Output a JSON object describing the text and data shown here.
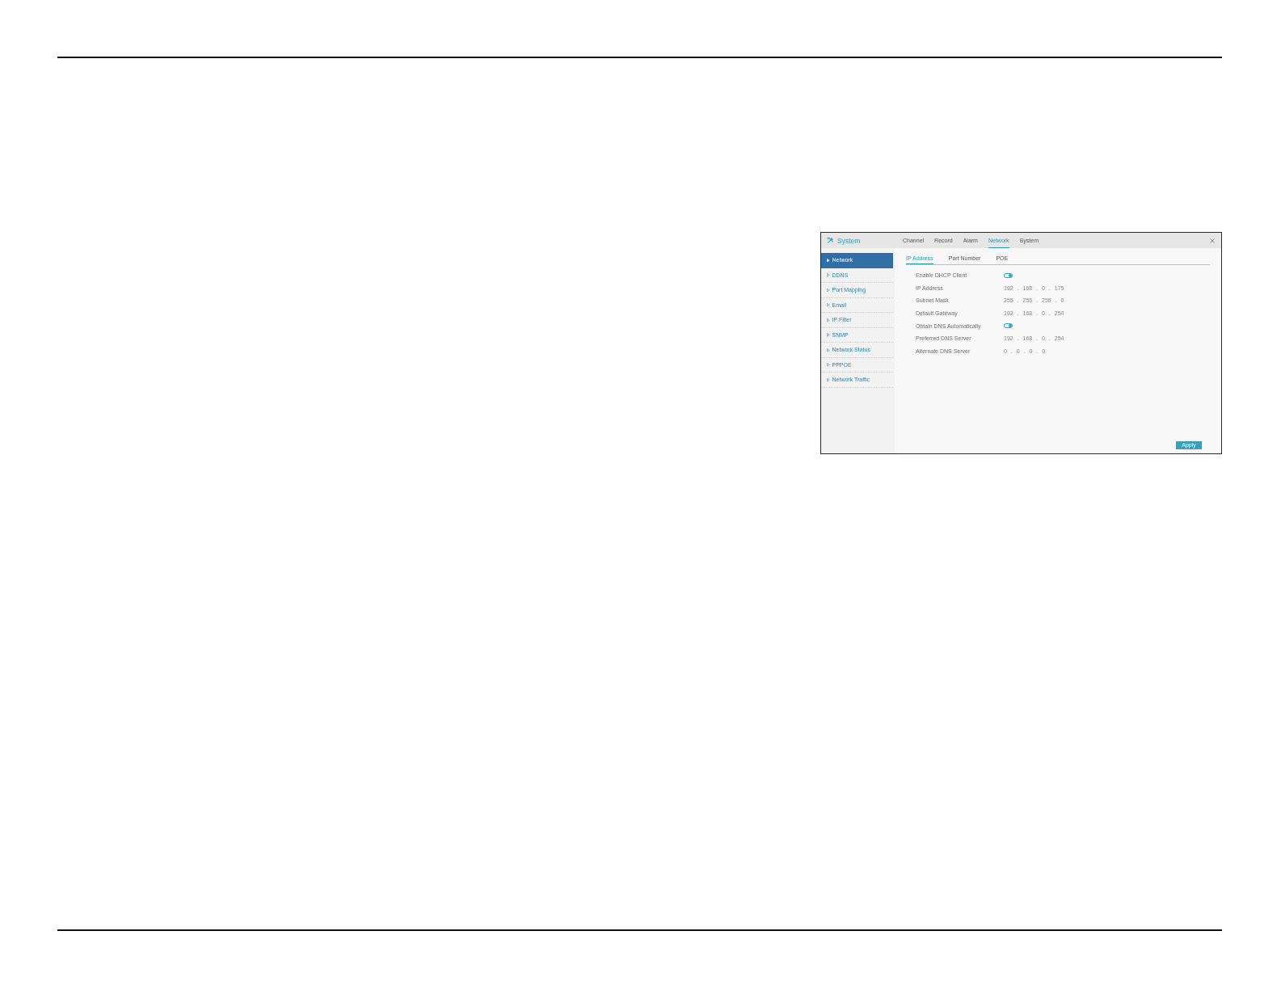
{
  "window": {
    "title": "System"
  },
  "tabs": [
    {
      "label": "Channel",
      "selected": false
    },
    {
      "label": "Record",
      "selected": false
    },
    {
      "label": "Alarm",
      "selected": false
    },
    {
      "label": "Network",
      "selected": true
    },
    {
      "label": "System",
      "selected": false
    }
  ],
  "sidebar": {
    "items": [
      {
        "label": "Network",
        "selected": true
      },
      {
        "label": "DDNS",
        "selected": false
      },
      {
        "label": "Port Mapping",
        "selected": false
      },
      {
        "label": "Email",
        "selected": false
      },
      {
        "label": "IP Filter",
        "selected": false
      },
      {
        "label": "SNMP",
        "selected": false
      },
      {
        "label": "Network Status",
        "selected": false
      },
      {
        "label": "PPPOE",
        "selected": false
      },
      {
        "label": "Network Traffic",
        "selected": false
      }
    ]
  },
  "subtabs": [
    {
      "label": "IP Address",
      "selected": true
    },
    {
      "label": "Port Number",
      "selected": false
    },
    {
      "label": "POE",
      "selected": false
    }
  ],
  "form": {
    "rows": [
      {
        "kind": "toggle",
        "label": "Enable DHCP Client",
        "on": true
      },
      {
        "kind": "ip",
        "label": "IP Address",
        "value": "192 . 168 . 0 . 175",
        "disabled": true
      },
      {
        "kind": "ip",
        "label": "Subnet Mask",
        "value": "255 . 255 . 255 . 0",
        "disabled": true
      },
      {
        "kind": "ip",
        "label": "Default Gateway",
        "value": "192 . 168 . 0 . 254",
        "disabled": true
      },
      {
        "kind": "toggle",
        "label": "Obtain DNS Automatically",
        "on": true
      },
      {
        "kind": "ip",
        "label": "Preferred DNS Server",
        "value": "192 . 168 . 0 . 254",
        "disabled": true
      },
      {
        "kind": "ip",
        "label": "Alternate DNS Server",
        "value": "0 . 0 . 0 . 0",
        "disabled": true
      }
    ]
  },
  "buttons": [
    "Apply"
  ]
}
